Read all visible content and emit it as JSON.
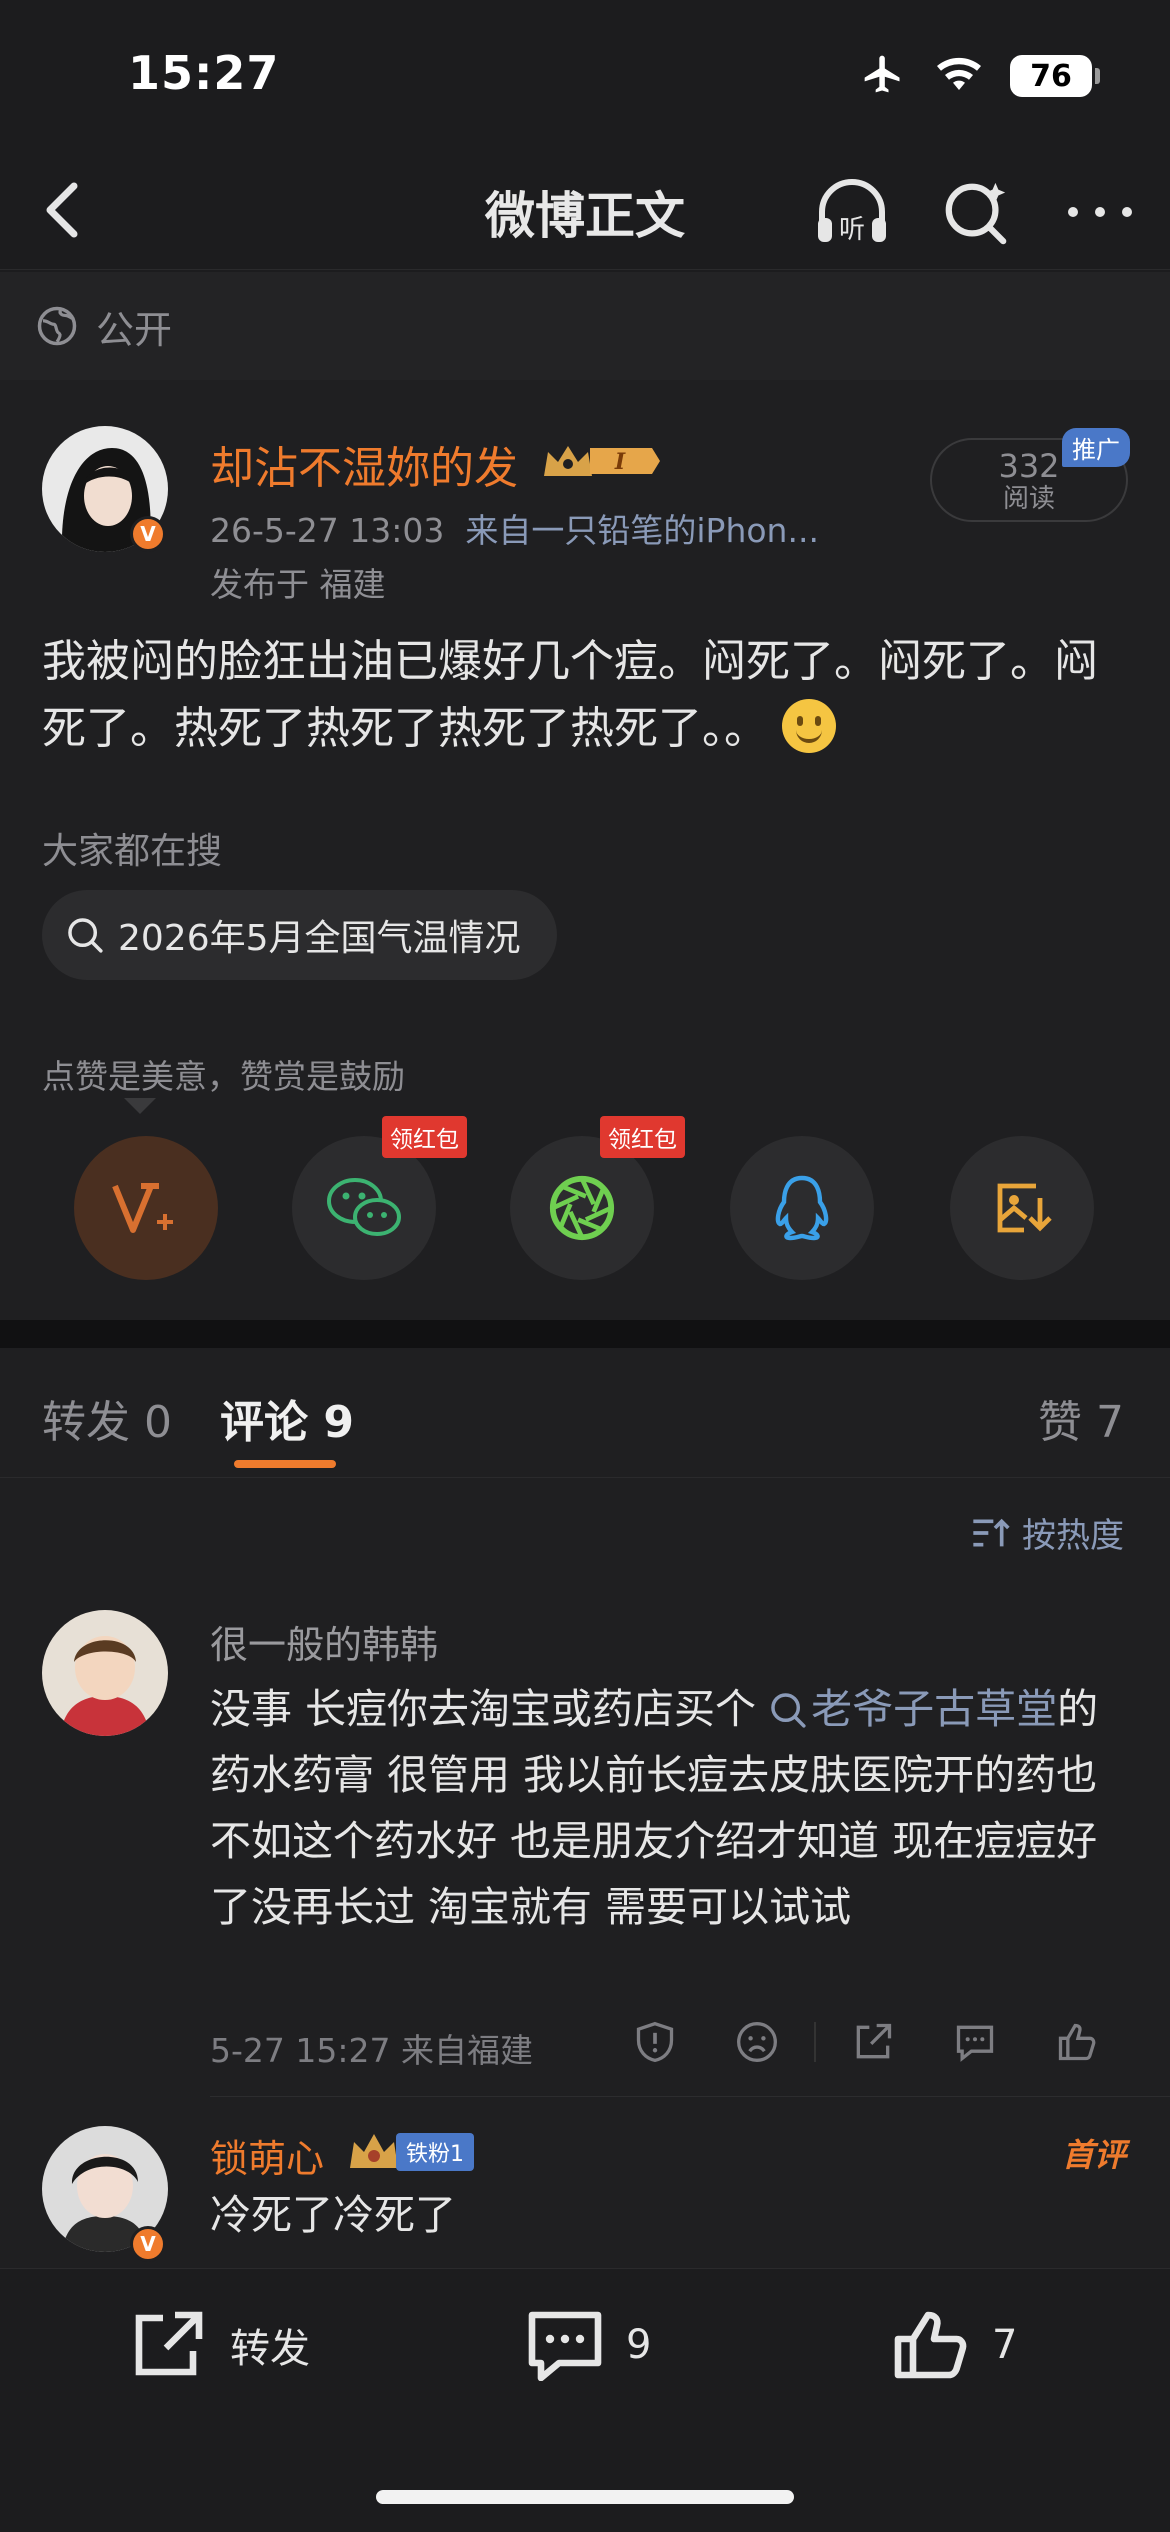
{
  "status_bar": {
    "time": "15:27",
    "battery": "76"
  },
  "nav": {
    "title": "微博正文"
  },
  "visibility": {
    "label": "公开"
  },
  "post": {
    "author": "却沾不湿妳的发",
    "timestamp": "26-5-27 13:03",
    "source": "来自一只铅笔的iPhon...",
    "location": "发布于 福建",
    "read_count": "332",
    "read_label": "阅读",
    "promo_tag": "推广",
    "body": "我被闷的脸狂出油已爆好几个痘。闷死了。闷死了。闷死了。热死了热死了热死了热死了。。",
    "search_label": "大家都在搜",
    "search_chip": "2026年5月全国气温情况",
    "reward_text": "点赞是美意，赞赏是鼓励",
    "red_packet_tag": "领红包"
  },
  "tabs": {
    "repost": "转发 0",
    "comment": "评论 9",
    "like": "赞 7"
  },
  "comments": {
    "sort_label": "按热度",
    "items": [
      {
        "name": "很一般的韩韩",
        "body_pre": "没事 长痘你去淘宝或药店买个 ",
        "body_link": "老爷子古草堂",
        "body_post": "的药水药膏 很管用 我以前长痘去皮肤医院开的药也不如这个药水好 也是朋友介绍才知道 现在痘痘好了没再长过 淘宝就有 需要可以试试",
        "meta": "5-27 15:27 来自福建"
      },
      {
        "name": "锁萌心",
        "fan_badge": "铁粉1",
        "first_tag": "首评",
        "body": "冷死了冷死了"
      }
    ]
  },
  "bottom_bar": {
    "repost_label": "转发",
    "comment_count": "9",
    "like_count": "7"
  },
  "colors": {
    "accent": "#ef7b2d",
    "background": "#1c1c1e",
    "link": "#8a9ab8"
  }
}
